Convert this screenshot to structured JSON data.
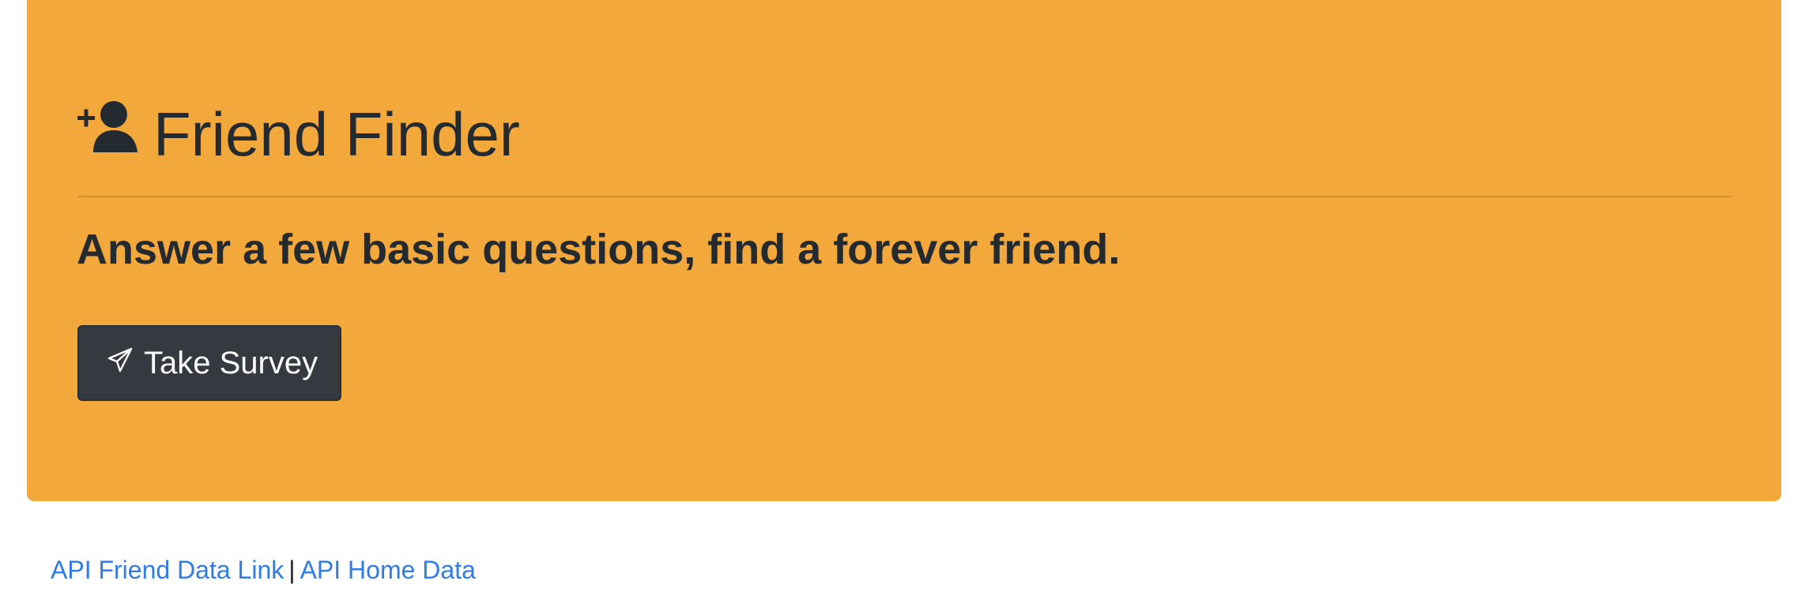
{
  "jumbotron": {
    "title": "Friend Finder",
    "title_icon": "user-plus-icon",
    "lead": "Answer a few basic questions, find a forever friend.",
    "button": {
      "label": "Take Survey",
      "icon": "paper-plane-icon"
    }
  },
  "footer": {
    "links": [
      {
        "label": "API Friend Data Link"
      },
      {
        "label": "API Home Data"
      }
    ],
    "separator": "|"
  },
  "colors": {
    "jumbotron_bg": "#f2a83b",
    "button_bg": "#343a40",
    "link": "#2f7ce8",
    "text": "#232a30"
  }
}
